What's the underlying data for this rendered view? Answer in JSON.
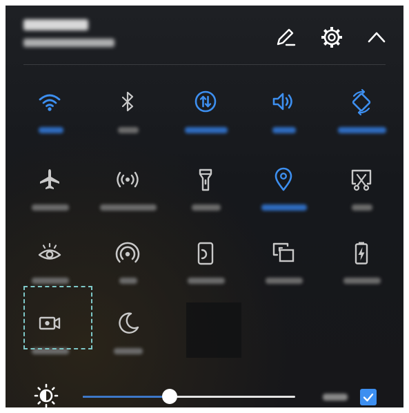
{
  "theme": {
    "active_color": "#3d8ff0",
    "inactive_color": "#c9c9c9",
    "label_active_color": "#2f6cc0",
    "label_inactive_color": "#6c6c6c",
    "selection_color": "#7fc9c9",
    "checkbox_color": "#3d8ff0"
  },
  "header": {
    "actions": [
      {
        "icon": "pencil-edit-icon"
      },
      {
        "icon": "gear-icon"
      },
      {
        "icon": "chevron-up-icon"
      }
    ]
  },
  "tiles": [
    {
      "id": "wifi",
      "icon": "wifi-icon",
      "active": true
    },
    {
      "id": "bluetooth",
      "icon": "bluetooth-icon",
      "active": false
    },
    {
      "id": "mobile-data",
      "icon": "mobile-data-icon",
      "active": true
    },
    {
      "id": "sound",
      "icon": "speaker-icon",
      "active": true
    },
    {
      "id": "auto-rotate",
      "icon": "auto-rotate-icon",
      "active": true
    },
    {
      "id": "airplane-mode",
      "icon": "airplane-icon",
      "active": false
    },
    {
      "id": "hotspot",
      "icon": "hotspot-icon",
      "active": false
    },
    {
      "id": "flashlight",
      "icon": "flashlight-icon",
      "active": false
    },
    {
      "id": "location",
      "icon": "location-pin-icon",
      "active": true
    },
    {
      "id": "screenshot",
      "icon": "screenshot-scissors-icon",
      "active": false
    },
    {
      "id": "eye-comfort",
      "icon": "eye-icon",
      "active": false
    },
    {
      "id": "nfc",
      "icon": "nfc-icon",
      "active": false
    },
    {
      "id": "one-hand",
      "icon": "one-hand-phone-icon",
      "active": false
    },
    {
      "id": "screen-mirror",
      "icon": "screen-mirror-icon",
      "active": false
    },
    {
      "id": "power-saving",
      "icon": "battery-saver-icon",
      "active": false
    },
    {
      "id": "screen-record",
      "icon": "screen-record-icon",
      "active": false,
      "highlighted": true
    },
    {
      "id": "do-not-disturb",
      "icon": "moon-icon",
      "active": false
    }
  ],
  "brightness": {
    "icon": "brightness-icon",
    "level": 0.41,
    "auto_checked": true
  }
}
